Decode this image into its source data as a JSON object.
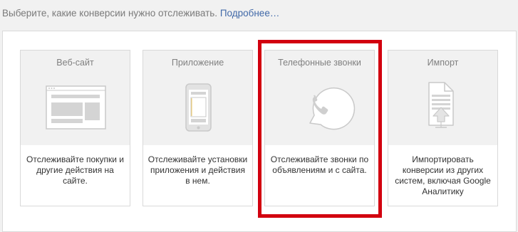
{
  "intro": {
    "text": "Выберите, какие конверсии нужно отслеживать.",
    "link": "Подробнее…"
  },
  "cards": [
    {
      "title": "Веб-сайт",
      "icon": "website-icon",
      "description": "Отслеживайте покупки и другие действия на сайте."
    },
    {
      "title": "Приложение",
      "icon": "mobile-app-icon",
      "description": "Отслеживайте установки приложения и действия в нем."
    },
    {
      "title": "Телефонные звонки",
      "icon": "phone-call-icon",
      "description": "Отслеживайте звонки по объявлениям и с сайта."
    },
    {
      "title": "Импорт",
      "icon": "import-icon",
      "description": "Импортировать конверсии из других систем, включая Google Аналитику"
    }
  ],
  "colors": {
    "page_bg": "#f1f1f1",
    "card_top_bg": "#f1f1f1",
    "link": "#4169a8",
    "highlight": "#d2000f",
    "icon": "#c9c9c9"
  }
}
